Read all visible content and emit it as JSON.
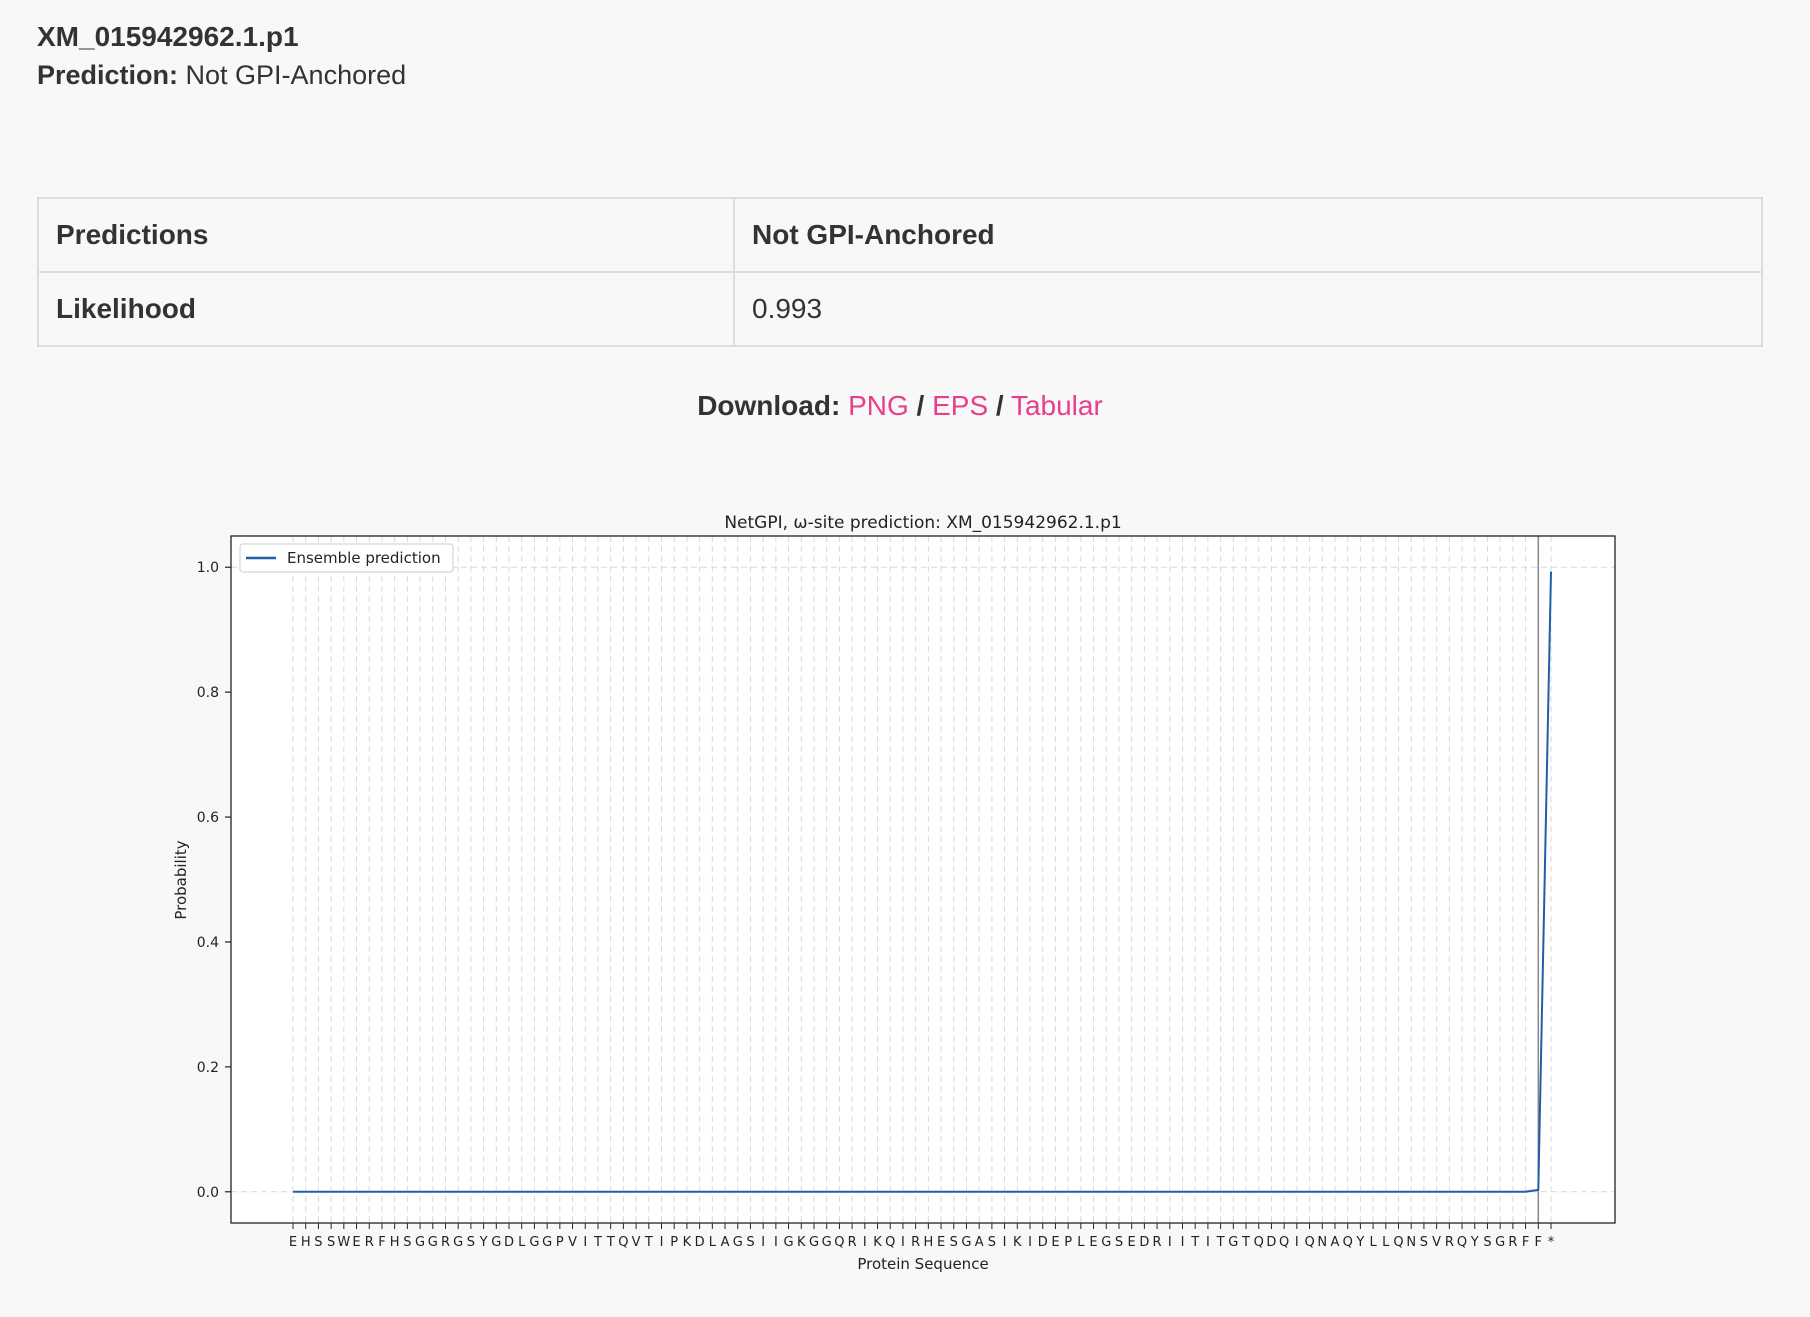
{
  "header": {
    "sequence_id": "XM_015942962.1.p1",
    "prediction_label": "Prediction:",
    "prediction_value": "Not GPI-Anchored"
  },
  "table": {
    "rows": [
      {
        "label": "Predictions",
        "value": "Not GPI-Anchored"
      },
      {
        "label": "Likelihood",
        "value": "0.993"
      }
    ]
  },
  "download": {
    "label": "Download:",
    "links": [
      "PNG",
      "EPS",
      "Tabular"
    ],
    "separator": "/"
  },
  "colors": {
    "link": "#e83e8c",
    "line": "#1f5fa8"
  },
  "chart_data": {
    "type": "line",
    "title": "NetGPI, ω-site prediction: XM_015942962.1.p1",
    "xlabel": "Protein Sequence",
    "ylabel": "Probability",
    "ylim": [
      -0.05,
      1.05
    ],
    "yticks": [
      0.0,
      0.2,
      0.4,
      0.6,
      0.8,
      1.0
    ],
    "grid": true,
    "legend_position": "top-left",
    "x": [
      "E",
      "H",
      "S",
      "S",
      "W",
      "E",
      "R",
      "F",
      "H",
      "S",
      "G",
      "G",
      "R",
      "G",
      "S",
      "Y",
      "G",
      "D",
      "L",
      "G",
      "G",
      "P",
      "V",
      "I",
      "T",
      "T",
      "Q",
      "V",
      "T",
      "I",
      "P",
      "K",
      "D",
      "L",
      "A",
      "G",
      "S",
      "I",
      "I",
      "G",
      "K",
      "G",
      "G",
      "Q",
      "R",
      "I",
      "K",
      "Q",
      "I",
      "R",
      "H",
      "E",
      "S",
      "G",
      "A",
      "S",
      "I",
      "K",
      "I",
      "D",
      "E",
      "P",
      "L",
      "E",
      "G",
      "S",
      "E",
      "D",
      "R",
      "I",
      "I",
      "T",
      "I",
      "T",
      "G",
      "T",
      "Q",
      "D",
      "Q",
      "I",
      "Q",
      "N",
      "A",
      "Q",
      "Y",
      "L",
      "L",
      "Q",
      "N",
      "S",
      "V",
      "R",
      "Q",
      "Y",
      "S",
      "G",
      "R",
      "F",
      "F",
      "*"
    ],
    "series": [
      {
        "name": "Ensemble prediction",
        "values": [
          0,
          0,
          0,
          0,
          0,
          0,
          0,
          0,
          0,
          0,
          0,
          0,
          0,
          0,
          0,
          0,
          0,
          0,
          0,
          0,
          0,
          0,
          0,
          0,
          0,
          0,
          0,
          0,
          0,
          0,
          0,
          0,
          0,
          0,
          0,
          0,
          0,
          0,
          0,
          0,
          0,
          0,
          0,
          0,
          0,
          0,
          0,
          0,
          0,
          0,
          0,
          0,
          0,
          0,
          0,
          0,
          0,
          0,
          0,
          0,
          0,
          0,
          0,
          0,
          0,
          0,
          0,
          0,
          0,
          0,
          0,
          0,
          0,
          0,
          0,
          0,
          0,
          0,
          0,
          0,
          0,
          0,
          0,
          0,
          0,
          0,
          0,
          0,
          0,
          0,
          0,
          0,
          0,
          0,
          0,
          0,
          0,
          0,
          0.003,
          0.993
        ]
      }
    ],
    "vline_index": 98
  }
}
